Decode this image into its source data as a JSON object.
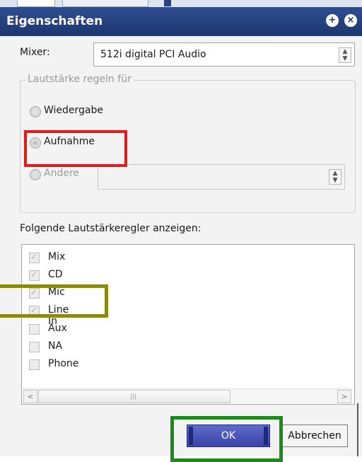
{
  "dialog": {
    "title": "Eigenschaften",
    "title_buttons": {
      "plus": "+",
      "close": "×"
    }
  },
  "mixer": {
    "label": "Mixer:",
    "value": "512i digital PCI Audio"
  },
  "volume_group": {
    "legend": "Lautstärke regeln für",
    "options": [
      {
        "label": "Wiedergabe",
        "selected": false,
        "enabled": false
      },
      {
        "label": "Aufnahme",
        "selected": true,
        "enabled": false
      },
      {
        "label": "Andere",
        "selected": false,
        "enabled": false
      }
    ],
    "other_select_value": ""
  },
  "controls_list": {
    "label": "Folgende Lautstärkeregler anzeigen:",
    "items": [
      {
        "label": "Mix",
        "checked": true
      },
      {
        "label": "CD",
        "checked": true
      },
      {
        "label": "Mic",
        "checked": true
      },
      {
        "label": "Line In",
        "checked": true
      },
      {
        "label": "Aux",
        "checked": false
      },
      {
        "label": "NA",
        "checked": false
      },
      {
        "label": "Phone",
        "checked": false
      }
    ]
  },
  "buttons": {
    "ok": "OK",
    "cancel": "Abbrechen"
  },
  "highlight_colors": {
    "recording": "#e21a1a",
    "mic": "#8a8a10",
    "ok": "#1c8a1c"
  }
}
